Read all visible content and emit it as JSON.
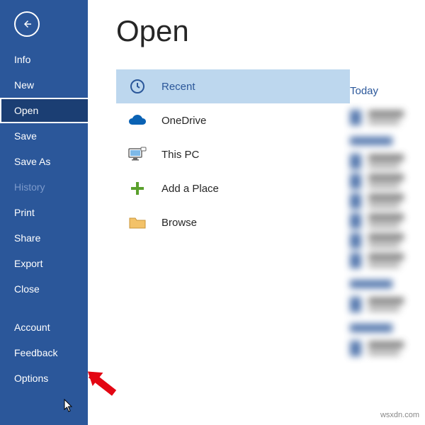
{
  "pageTitle": "Open",
  "sidebar": {
    "items": [
      {
        "label": "Info",
        "selected": false,
        "disabled": false
      },
      {
        "label": "New",
        "selected": false,
        "disabled": false
      },
      {
        "label": "Open",
        "selected": true,
        "disabled": false
      },
      {
        "label": "Save",
        "selected": false,
        "disabled": false
      },
      {
        "label": "Save As",
        "selected": false,
        "disabled": false
      },
      {
        "label": "History",
        "selected": false,
        "disabled": true
      },
      {
        "label": "Print",
        "selected": false,
        "disabled": false
      },
      {
        "label": "Share",
        "selected": false,
        "disabled": false
      },
      {
        "label": "Export",
        "selected": false,
        "disabled": false
      },
      {
        "label": "Close",
        "selected": false,
        "disabled": false
      }
    ],
    "bottom": [
      {
        "label": "Account"
      },
      {
        "label": "Feedback"
      },
      {
        "label": "Options"
      }
    ]
  },
  "locations": [
    {
      "label": "Recent",
      "icon": "clock",
      "selected": true
    },
    {
      "label": "OneDrive",
      "icon": "onedrive",
      "selected": false
    },
    {
      "label": "This PC",
      "icon": "pc",
      "selected": false
    },
    {
      "label": "Add a Place",
      "icon": "plus",
      "selected": false
    },
    {
      "label": "Browse",
      "icon": "folder",
      "selected": false
    }
  ],
  "recent": {
    "header": "Today"
  },
  "watermark": "wsxdn.com"
}
